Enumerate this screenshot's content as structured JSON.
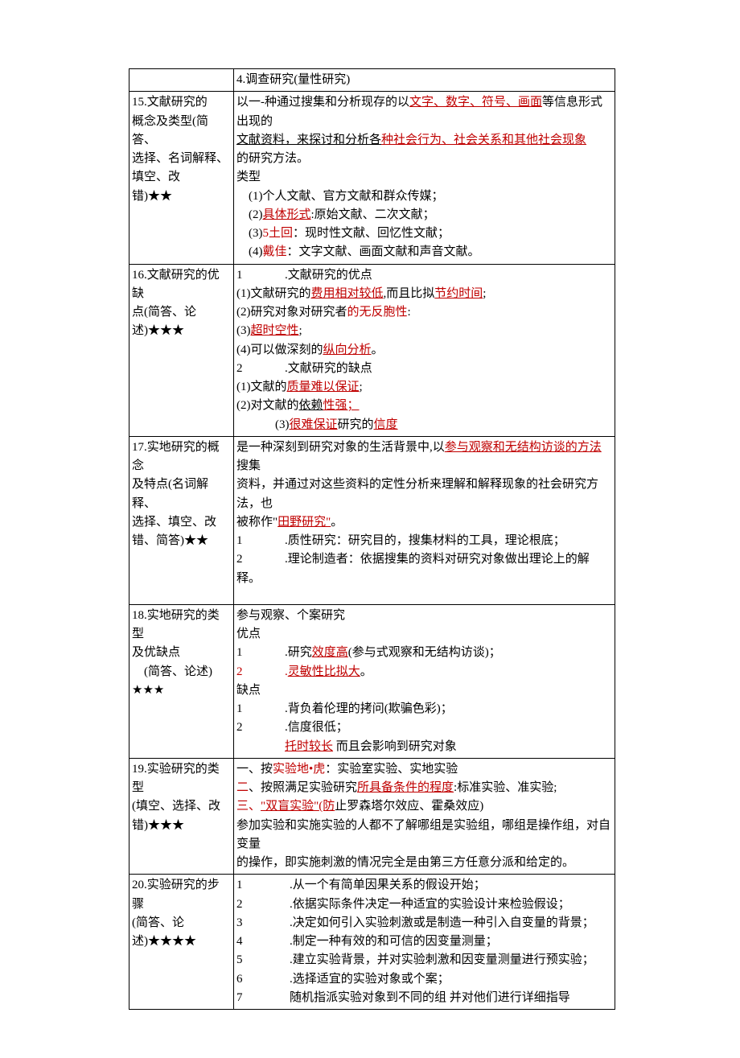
{
  "r0": {
    "c": "4.调查研究(量性研究)"
  },
  "r1": {
    "l1": "15.文献研究的",
    "l2": "概念及类型(简答、",
    "l3": "选择、名词解释、",
    "l4": "填空、改",
    "l5": "错)★★",
    "p1a": "以一-种通过搜集和分析现存的以",
    "p1b": "文字、数字、符号、画面",
    "p1c": "等信息形式出现的",
    "p2a": "文献资料，来探讨和分析各",
    "p2b": "种社会行为、社会关系和其他社会现象",
    "p3": "的研究方法。",
    "p4": "类型",
    "p5": "　(1)个人文献、官方文献和群众传媒；",
    "p6a": "　(2)",
    "p6b": "具体形式",
    "p6c": ":原始文献、二次文献；",
    "p7a": "　(3)",
    "p7b": "5土回",
    "p7c": "：现时性文献、回忆性文献；",
    "p8a": "　(4)",
    "p8b": "戴佳",
    "p8c": "：文字文献、画面文献和声音文献。"
  },
  "r2": {
    "l1": "16.文献研究的优缺",
    "l2": "点(简答、论",
    "l3": "述)★★★",
    "h1": ".文献研究的优点",
    "a1a": "(1)文献研究的",
    "a1b": "费用相对较低",
    "a1c": ",而且比拟",
    "a1d": "节约时间",
    "a1e": ";",
    "a2a": "(2)研究对象对研究者",
    "a2b": "的无反胞性",
    "a2c": ":",
    "a3a": "(3)",
    "a3b": "超时空性",
    "a3c": ";",
    "a4a": "(4)可以做深刻的",
    "a4b": "纵向",
    "a4c": "分析",
    "a4d": "。",
    "h2": ".文献研究的缺点",
    "b1a": "(1)文献的",
    "b1b": "质量难以保证",
    "b1c": ";",
    "b2a": "(2)对文献的",
    "b2b": "依赖",
    "b2c": "性强；",
    "b3a": "(3)",
    "b3b": "很难保证",
    "b3c": "研究的",
    "b3d": "信度"
  },
  "r3": {
    "l1": "17.实地研究的概念",
    "l2": "及特点(名词解释、",
    "l3": "选择、填空、改",
    "l4": "错、简答)★★",
    "p1a": "是一种深刻到研究对象的生活背景中,以",
    "p1b": "参与观察和无结构访谈的方法",
    "p1c": "搜集",
    "p2": "资料，并通过对这些资料的定性分析来理解和解释现象的社会研究方法，也",
    "p3a": "被称作\"",
    "p3b": "田野研究\"",
    "p3c": "。",
    "n1": ".质性研究：研究目的，搜集材料的工具，理论根底；",
    "n2": ".理论制造者：依据搜集的资料对研究对象做出理论上的解释。"
  },
  "r4": {
    "l1": "18.实地研究的类型",
    "l2": "及优缺点",
    "l3": "　(简答、论述)",
    "l4": "★★★",
    "p1": "参与观察、个案研究",
    "p2": "优点",
    "a1a": ".研究",
    "a1b": "效度高",
    "a1c": "(参与式观察和无结构访谈)；",
    "a2a": ".",
    "a2b": "灵敏性比拟大",
    "a2c": "。",
    "p3": "缺点",
    "b1": ".背负着伦理的拷问(欺骗色彩)；",
    "b2": ".信度很低；",
    "b3a": "托时较长",
    "b3b": "  而且会影响到研究对象"
  },
  "r5": {
    "l1": "19.实验研究的类型",
    "l2": "(填空、选择、改",
    "l3": "错)★★★",
    "p1a": "一、按",
    "p1b": "实验地•虎",
    "p1c": "：实验室实验、实地实验",
    "p2a": "二",
    "p2b": "、按照满足实验研究",
    "p2c": "所具备条件的程度",
    "p2d": ":标准实验、准实验;",
    "p3a": "三、",
    "p3b": "\"双盲实验\"",
    "p3c": "(防",
    "p3d": "止罗森塔尔效应、霍桑效应)",
    "p4": "参加实验和实施实验的人都不了解哪组是实验组，哪组是操作组，对自变量",
    "p5": "的操作，即实施刺激的情况完全是由第三方任意分派和给定的。"
  },
  "r6": {
    "l1": "20.实验研究的步骤",
    "l2": "(简答、论",
    "l3": "述)★★★★",
    "n1": ".从一个有简单因果关系的假设开始；",
    "n2": ".依据实际条件决定一种适宜的实验设计来检验假设；",
    "n3": ".决定如何引入实验刺激或是制造一种引入自变量的背景；",
    "n4": ".制定一种有效的和可信的因变量测量；",
    "n5": ".建立实验背景，并对实验刺激和因变量测量进行预实验；",
    "n6": ".选择适宜的实验对象或个案；",
    "n7": "随机指派实验对象到不同的组   并对他们进行详细指导"
  }
}
